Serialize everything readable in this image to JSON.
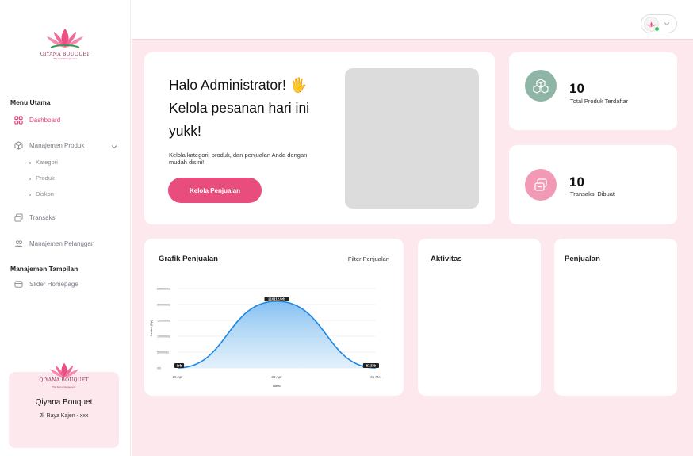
{
  "brand": {
    "logo_text": "QIYANA BOUQUET",
    "logo_tagline": "The best arrangement"
  },
  "sidebar": {
    "section_main": "Menu Utama",
    "items": [
      {
        "label": "Dashboard",
        "icon": "grid-icon",
        "active": true
      },
      {
        "label": "Manajemen Produk",
        "icon": "cube-icon"
      },
      {
        "label": "Transaksi",
        "icon": "transaction-icon"
      },
      {
        "label": "Manajemen Pelanggan",
        "icon": "users-icon"
      }
    ],
    "produk_sub": [
      "Kategori",
      "Produk",
      "Diskon"
    ],
    "section_display": "Manajemen Tampilan",
    "display_items": [
      {
        "label": "Slider Homepage",
        "icon": "slider-icon"
      }
    ],
    "store": {
      "name": "Qiyana Bouquet",
      "address": "Jl. Raya Kajen - xxx"
    }
  },
  "welcome": {
    "greeting": "Halo Administrator! 🖐️ Kelola pesanan hari ini yukk!",
    "description": "Kelola kategori, produk, dan penjualan Anda dengan mudah disini!",
    "button_label": "Kelola Penjualan"
  },
  "stats": [
    {
      "value": "10",
      "label": "Total Produk Terdaftar",
      "color": "#8fb5a6"
    },
    {
      "value": "10",
      "label": "Transaksi Dibuat",
      "color": "#f29ab5"
    }
  ],
  "sales_card": {
    "title": "Grafik Penjualan",
    "filter_label": "Filter Penjualan"
  },
  "activity_card": {
    "title": "Aktivitas"
  },
  "penjualan_card": {
    "title": "Penjualan"
  },
  "colors": {
    "accent": "#e84d7e",
    "background": "#fde8ee",
    "chart_line": "#1e88e5"
  },
  "chart_data": {
    "type": "area",
    "x": [
      "28 Apr",
      "30 Apr",
      "01 Mei"
    ],
    "y": [
      0,
      210112.5,
      0
    ],
    "point_labels": [
      "0rb",
      "210112.5rb",
      "87,5rb"
    ],
    "yticks": [
      "0rb",
      "50000rbs",
      "100000rbs",
      "150000rbs",
      "200000rbs",
      "250000rbs"
    ],
    "ylim": [
      0,
      250000
    ],
    "xlabel": "Waktu",
    "ylabel": "Jumlah (Rp)",
    "grid": true
  }
}
